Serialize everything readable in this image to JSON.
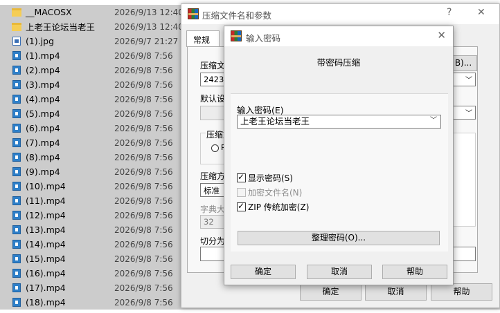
{
  "files": [
    {
      "name": "__MACOSX",
      "date": "2026/9/13 12:40",
      "type": "folder"
    },
    {
      "name": "上老王论坛当老王",
      "date": "2026/9/13 12:40",
      "type": "folder"
    },
    {
      "name": "(1).jpg",
      "date": "2026/9/7 21:27",
      "type": "image"
    },
    {
      "name": "(1).mp4",
      "date": "2026/9/8 7:56",
      "type": "video"
    },
    {
      "name": "(2).mp4",
      "date": "2026/9/8 7:56",
      "type": "video"
    },
    {
      "name": "(3).mp4",
      "date": "2026/9/8 7:56",
      "type": "video"
    },
    {
      "name": "(4).mp4",
      "date": "2026/9/8 7:56",
      "type": "video"
    },
    {
      "name": "(5).mp4",
      "date": "2026/9/8 7:56",
      "type": "video"
    },
    {
      "name": "(6).mp4",
      "date": "2026/9/8 7:56",
      "type": "video"
    },
    {
      "name": "(7).mp4",
      "date": "2026/9/8 7:56",
      "type": "video"
    },
    {
      "name": "(8).mp4",
      "date": "2026/9/8 7:56",
      "type": "video"
    },
    {
      "name": "(9).mp4",
      "date": "2026/9/8 7:56",
      "type": "video"
    },
    {
      "name": "(10).mp4",
      "date": "2026/9/8 7:56",
      "type": "video"
    },
    {
      "name": "(11).mp4",
      "date": "2026/9/8 7:56",
      "type": "video"
    },
    {
      "name": "(12).mp4",
      "date": "2026/9/8 7:56",
      "type": "video"
    },
    {
      "name": "(13).mp4",
      "date": "2026/9/8 7:56",
      "type": "video"
    },
    {
      "name": "(14).mp4",
      "date": "2026/9/8 7:56",
      "type": "video"
    },
    {
      "name": "(15).mp4",
      "date": "2026/9/8 7:56",
      "type": "video"
    },
    {
      "name": "(16).mp4",
      "date": "2026/9/8 7:56",
      "type": "video"
    },
    {
      "name": "(17).mp4",
      "date": "2026/9/8 7:56",
      "type": "video"
    },
    {
      "name": "(18).mp4",
      "date": "2026/9/8 7:56",
      "type": "video"
    }
  ],
  "archive_dialog": {
    "title": "压缩文件名和参数",
    "help_glyph": "?",
    "close_glyph": "✕",
    "tab_general": "常规",
    "archive_name_label": "压缩文",
    "archive_name_value": "2423.z",
    "browse_button": "B)...",
    "default_profile_label": "默认设",
    "format_group_label": "压缩文",
    "format_radio": "R",
    "method_label": "压缩方",
    "method_value": "标准",
    "dict_label": "字典大",
    "dict_value": "32",
    "split_label": "切分为",
    "ok": "确定",
    "cancel": "取消",
    "help": "帮助"
  },
  "password_dialog": {
    "title": "输入密码",
    "close_glyph": "✕",
    "heading": "带密码压缩",
    "input_label": "输入密码(E)",
    "password_value": "上老王论坛当老王",
    "show_password": {
      "label": "显示密码(S)",
      "checked": true,
      "disabled": false
    },
    "encrypt_names": {
      "label": "加密文件名(N)",
      "checked": false,
      "disabled": true
    },
    "zip_legacy": {
      "label": "ZIP 传统加密(Z)",
      "checked": true,
      "disabled": false
    },
    "organize_button": "整理密码(O)...",
    "ok": "确定",
    "cancel": "取消",
    "help": "帮助"
  }
}
